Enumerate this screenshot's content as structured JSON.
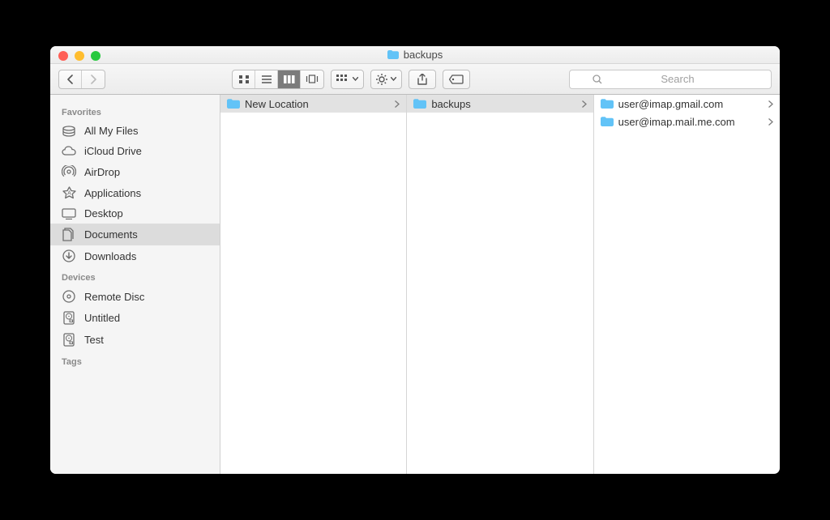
{
  "window": {
    "title": "backups"
  },
  "toolbar": {
    "active_view": "columns",
    "search_placeholder": "Search"
  },
  "sidebar": {
    "sections": [
      {
        "title": "Favorites",
        "items": [
          {
            "label": "All My Files",
            "icon": "all-my-files",
            "selected": false
          },
          {
            "label": "iCloud Drive",
            "icon": "icloud",
            "selected": false
          },
          {
            "label": "AirDrop",
            "icon": "airdrop",
            "selected": false
          },
          {
            "label": "Applications",
            "icon": "applications",
            "selected": false
          },
          {
            "label": "Desktop",
            "icon": "desktop",
            "selected": false
          },
          {
            "label": "Documents",
            "icon": "documents",
            "selected": true
          },
          {
            "label": "Downloads",
            "icon": "downloads",
            "selected": false
          }
        ]
      },
      {
        "title": "Devices",
        "items": [
          {
            "label": "Remote Disc",
            "icon": "remote-disc",
            "selected": false
          },
          {
            "label": "Untitled",
            "icon": "hdd",
            "selected": false
          },
          {
            "label": "Test",
            "icon": "hdd",
            "selected": false
          }
        ]
      },
      {
        "title": "Tags",
        "items": []
      }
    ]
  },
  "columns": [
    {
      "items": [
        {
          "label": "New Location",
          "has_children": true,
          "selected": true
        }
      ]
    },
    {
      "items": [
        {
          "label": "backups",
          "has_children": true,
          "selected": true
        }
      ]
    },
    {
      "items": [
        {
          "label": "user@imap.gmail.com",
          "has_children": true,
          "selected": false
        },
        {
          "label": "user@imap.mail.me.com",
          "has_children": true,
          "selected": false
        }
      ]
    }
  ],
  "colors": {
    "folder": "#62c3f7",
    "selection": "#dcdcdc"
  }
}
